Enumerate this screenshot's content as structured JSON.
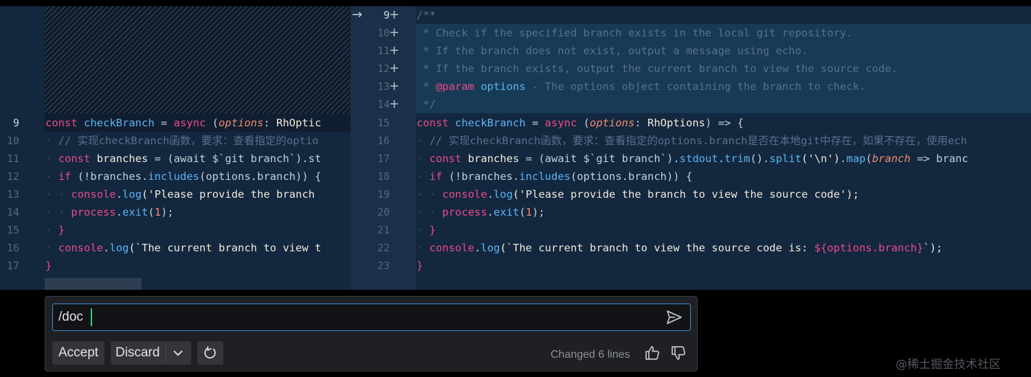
{
  "editor": {
    "left": {
      "current_line_number": "9",
      "line_numbers": [
        "10",
        "11",
        "12",
        "13",
        "14",
        "15",
        "16",
        "17"
      ]
    },
    "right": {
      "line_numbers": [
        "9",
        "10",
        "11",
        "12",
        "13",
        "14",
        "15",
        "16",
        "17",
        "18",
        "19",
        "20",
        "21",
        "22",
        "23"
      ],
      "added_marker": "+",
      "arrow": "→"
    },
    "code": {
      "comment_open": "/**",
      "c1": " * Check if the specified branch exists in the local git repository.",
      "c2": " * If the branch does not exist, output a message using echo.",
      "c3": " * If the branch exists, output the current branch to view the source code.",
      "c4_star": " * ",
      "c4_tag": "@param",
      "c4_name": " options",
      "c4_rest": " - The options object containing the branch to check.",
      "comment_close": " */",
      "kw_const": "const",
      "fn_checkBranch": "checkBranch",
      "op_eq": " = ",
      "kw_async": "async",
      "paren_open": " (",
      "param_options": "options",
      "colon": ": ",
      "type_left": "RhOptic",
      "type_right": "RhOptions",
      "arrow_tail": ") => {",
      "comment_line_left": "// 实现checkBranch函数，要求：查看指定的optio",
      "comment_line_right": "// 实现checkBranch函数，要求：查看指定的options.branch是否在本地git中存在，如果不存在，使用ech",
      "branches": "branches",
      "await_open": " = (await $`git branch`)",
      "await_left_tail": ".st",
      "dot": ".",
      "stdout": "stdout",
      "trim": "trim",
      "split": "split",
      "split_arg": "('\\n')",
      "map": "map",
      "map_param": "branch",
      "map_tail": " => branc",
      "kw_if": "if",
      "if_open": " (!branches.",
      "includes": "includes",
      "includes_arg": "(options.branch))",
      "if_left_tail": " {",
      "if_right_tail": " {",
      "console": "console",
      "log": "log",
      "msg_left": "('Please provide the branch ",
      "msg_right": "('Please provide the branch to view the source code');",
      "process": "process",
      "exit": "exit",
      "exit_open": "(",
      "exit_num": "1",
      "exit_close": ");",
      "close_brace": "}",
      "log2_left": "(`The current branch to view t",
      "log2_right_a": "(`The current branch to view the source code is: ",
      "log2_right_tpl": "${options.branch}",
      "log2_right_b": "`);",
      "guide": "·"
    }
  },
  "prompt": {
    "input_value": "/doc",
    "accept_label": "Accept",
    "discard_label": "Discard",
    "status": "Changed 6 lines"
  },
  "icons": {
    "send": "send-icon",
    "chevron": "chevron-down-icon",
    "reload": "refresh-icon",
    "thumbs_up": "thumbs-up-icon",
    "thumbs_down": "thumbs-down-icon"
  },
  "watermark": "@稀土掘金技术社区"
}
